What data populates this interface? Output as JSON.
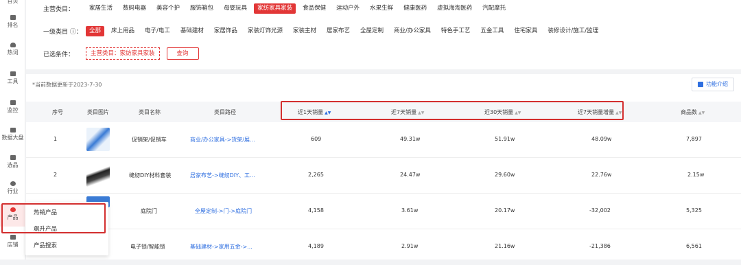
{
  "sidebar": {
    "items": [
      {
        "label": "首页"
      },
      {
        "label": "排名"
      },
      {
        "label": "热词"
      },
      {
        "label": "工具"
      },
      {
        "label": "监控"
      },
      {
        "label": "数据大盘"
      },
      {
        "label": "选品"
      },
      {
        "label": "行业"
      },
      {
        "label": "产品"
      },
      {
        "label": "店铺"
      }
    ]
  },
  "filter": {
    "main_label": "主营类目：",
    "main_categories": [
      "家居生活",
      "数码电器",
      "美容个护",
      "服饰箱包",
      "母婴玩具",
      "家纺家具家装",
      "食品保健",
      "运动户外",
      "水果生鲜",
      "健康医药",
      "虚拟海淘医药",
      "汽配摩托"
    ],
    "main_selected": "家纺家具家装",
    "sub_label": "一级类目 ⓘ：",
    "sub_categories": [
      "全部",
      "床上用品",
      "电子/电工",
      "基础建材",
      "家居饰品",
      "家装灯饰光源",
      "家装主材",
      "居家布艺",
      "全屋定制",
      "商业/办公家具",
      "特色手工艺",
      "五金工具",
      "住宅家具",
      "装修设计/施工/监理"
    ],
    "sub_selected": "全部",
    "cond_label": "已选条件：",
    "cond_value": "主营类目：家纺家具家装",
    "query_label": "查询"
  },
  "panel": {
    "update_text": "*当前数据更新于2023-7-30",
    "func_label": "功能介绍"
  },
  "table": {
    "headers": [
      "序号",
      "类目图片",
      "类目名称",
      "类目路径",
      "近1天销量",
      "近7天销量",
      "近30天销量",
      "近7天销量增量",
      "商品数"
    ],
    "rows": [
      {
        "idx": "1",
        "name": "促销架/促销车",
        "path": "商业/办公家具->货架/展...",
        "d1": "609",
        "d7": "49.31w",
        "d30": "51.91w",
        "inc": "48.09w",
        "count": "7,897"
      },
      {
        "idx": "2",
        "name": "缝纫DIY材料套装",
        "path": "居家布艺->缝纫DIY、工...",
        "d1": "2,265",
        "d7": "24.47w",
        "d30": "29.60w",
        "inc": "22.76w",
        "count": "2.15w"
      },
      {
        "idx": "",
        "name": "庭院门",
        "path": "全屋定制->门->庭院门",
        "d1": "4,158",
        "d7": "3.61w",
        "d30": "20.17w",
        "inc": "-32,002",
        "count": "5,325"
      },
      {
        "idx": "",
        "name": "电子锁/智能锁",
        "path": "基础建材->家用五金->...",
        "d1": "4,189",
        "d7": "2.91w",
        "d30": "21.16w",
        "inc": "-21,386",
        "count": "6,561"
      }
    ]
  },
  "popup": {
    "items": [
      "热销产品",
      "飙升产品",
      "产品搜索"
    ]
  },
  "colors": {
    "accent": "#e23636",
    "link": "#2f6fe0",
    "highlight": "#d32f2f"
  }
}
